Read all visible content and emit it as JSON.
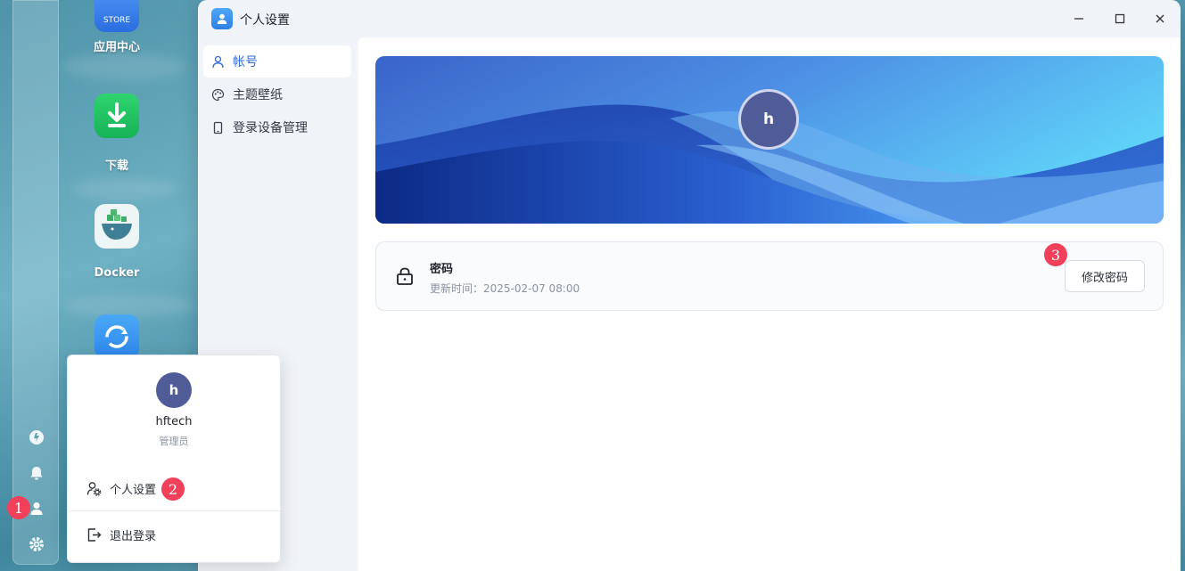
{
  "desktop": {
    "apps": [
      {
        "label": "应用中心",
        "tile_text": "STORE",
        "color": "#3a7ff0"
      },
      {
        "label": "下载",
        "color": "#20c460"
      },
      {
        "label": "Docker",
        "color": "#e8f2f4"
      },
      {
        "label": "",
        "color": "#3a9cf5"
      }
    ]
  },
  "dock": {
    "items": [
      {
        "name": "dashboard-icon"
      },
      {
        "name": "bell-icon"
      },
      {
        "name": "user-icon"
      },
      {
        "name": "gear-icon"
      }
    ]
  },
  "annotations": {
    "step1": "1",
    "step2": "2",
    "step3": "3",
    "color": "#f2405b"
  },
  "window": {
    "title": "个人设置",
    "controls": {
      "minimize": "—",
      "maximize": "☐",
      "close": "✕"
    },
    "nav": [
      {
        "label": "帐号",
        "active": true
      },
      {
        "label": "主题壁纸",
        "active": false
      },
      {
        "label": "登录设备管理",
        "active": false
      }
    ],
    "account": {
      "avatar_letter": "h",
      "password": {
        "title": "密码",
        "updated": "更新时间：2025-02-07 08:00",
        "button": "修改密码"
      }
    }
  },
  "user_menu": {
    "avatar_letter": "h",
    "username": "hftech",
    "role": "管理员",
    "items": [
      {
        "label": "个人设置"
      },
      {
        "label": "退出登录"
      }
    ]
  },
  "colors": {
    "accent": "#2f6bdb",
    "avatar": "#505c98"
  }
}
